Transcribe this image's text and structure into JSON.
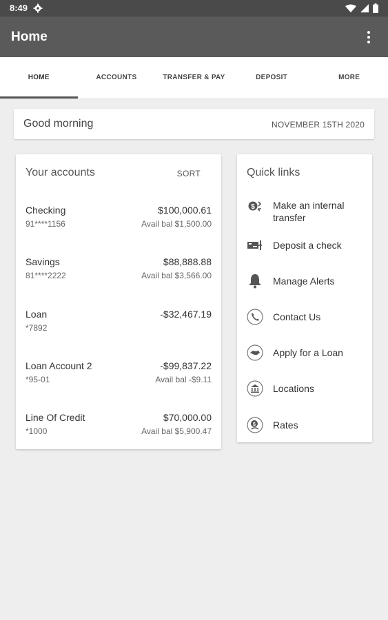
{
  "status_bar": {
    "time": "8:49",
    "icons": [
      "gear-icon",
      "wifi-icon",
      "signal-icon",
      "battery-icon"
    ]
  },
  "app_bar": {
    "title": "Home",
    "menu_icon": "more-vert-icon"
  },
  "tabs": [
    {
      "label": "HOME",
      "active": true
    },
    {
      "label": "ACCOUNTS",
      "active": false
    },
    {
      "label": "TRANSFER & PAY",
      "active": false
    },
    {
      "label": "DEPOSIT",
      "active": false
    },
    {
      "label": "MORE",
      "active": false
    }
  ],
  "greeting": {
    "text": "Good morning",
    "date": "NOVEMBER 15TH 2020"
  },
  "accounts": {
    "title": "Your accounts",
    "sort_label": "SORT",
    "items": [
      {
        "name": "Checking",
        "number": "91****1156",
        "amount": "$100,000.61",
        "available": "Avail bal $1,500.00"
      },
      {
        "name": "Savings",
        "number": "81****2222",
        "amount": "$88,888.88",
        "available": "Avail bal $3,566.00"
      },
      {
        "name": "Loan",
        "number": "*7892",
        "amount": "-$32,467.19",
        "available": ""
      },
      {
        "name": "Loan Account 2",
        "number": "*95-01",
        "amount": "-$99,837.22",
        "available": "Avail bal -$9.11"
      },
      {
        "name": "Line Of Credit",
        "number": "*1000",
        "amount": "$70,000.00",
        "available": "Avail bal $5,900.47"
      }
    ]
  },
  "quick_links": {
    "title": "Quick links",
    "items": [
      {
        "label_line1": "Make an internal",
        "label_line2": "transfer",
        "icon": "transfer-icon"
      },
      {
        "label_line1": "Deposit a check",
        "label_line2": "",
        "icon": "check-deposit-icon"
      },
      {
        "label_line1": "Manage Alerts",
        "label_line2": "",
        "icon": "bell-icon"
      },
      {
        "label_line1": "Contact Us",
        "label_line2": "",
        "icon": "phone-icon"
      },
      {
        "label_line1": "Apply for a Loan",
        "label_line2": "",
        "icon": "handshake-icon"
      },
      {
        "label_line1": "Locations",
        "label_line2": "",
        "icon": "bank-icon"
      },
      {
        "label_line1": "Rates",
        "label_line2": "",
        "icon": "rates-icon"
      }
    ]
  },
  "colors": {
    "status_bar": "#4a4a4a",
    "app_bar": "#5a5a5a",
    "background": "#eeeeee",
    "card": "#ffffff",
    "tab_indicator": "#555555"
  }
}
